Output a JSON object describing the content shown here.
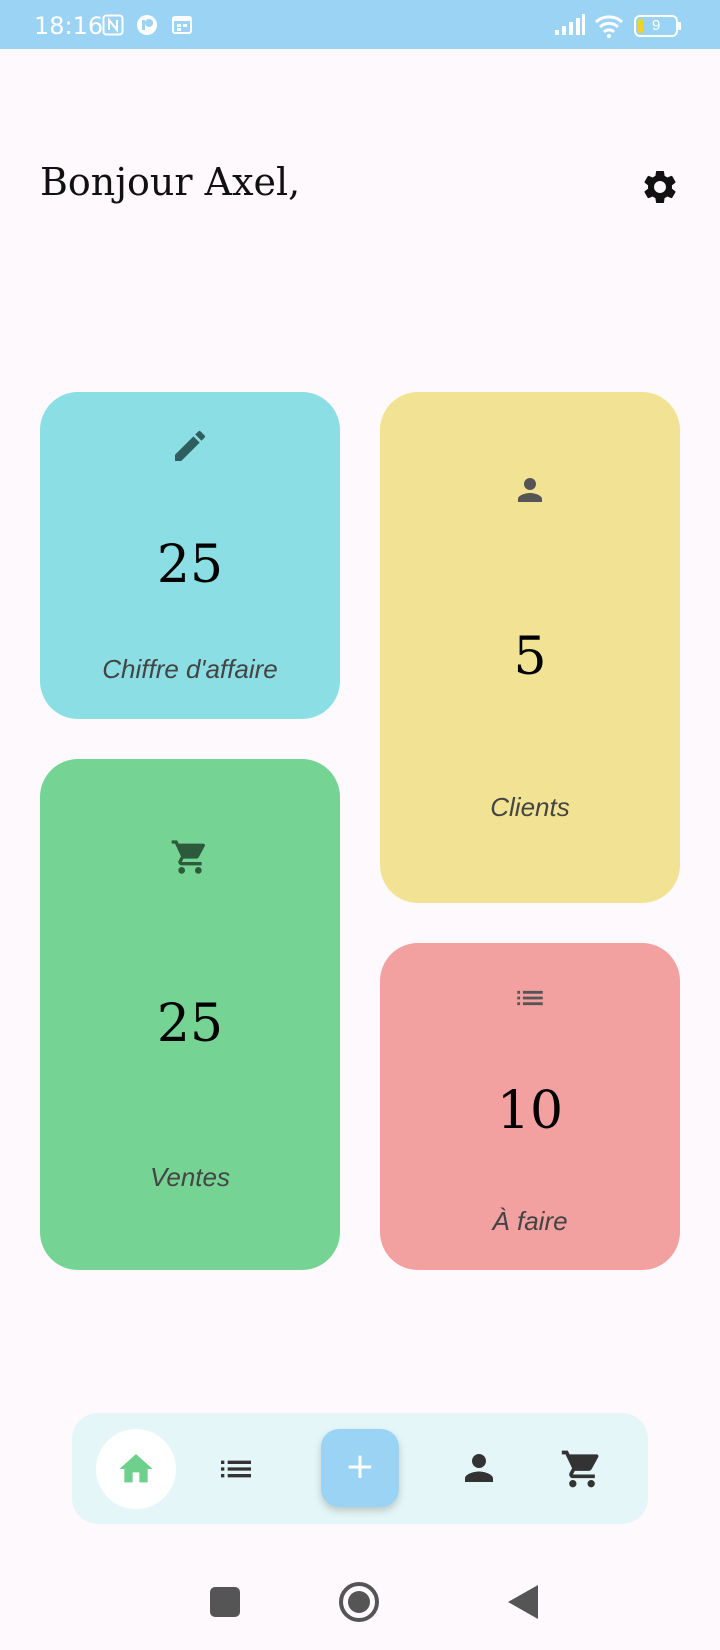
{
  "status_bar": {
    "time": "18:16",
    "battery_level": "9",
    "icons": [
      "nfc-icon",
      "app-notification-icon",
      "calendar-icon",
      "signal-icon",
      "wifi-icon",
      "battery-icon"
    ]
  },
  "header": {
    "greeting": "Bonjour Axel,",
    "settings_icon": "gear-icon"
  },
  "cards": {
    "revenue": {
      "value": "25",
      "label": "Chiffre d'affaire",
      "icon": "pencil-icon",
      "color": "#8bdfe4"
    },
    "clients": {
      "value": "5",
      "label": "Clients",
      "icon": "person-icon",
      "color": "#f2e394"
    },
    "sales": {
      "value": "25",
      "label": "Ventes",
      "icon": "cart-icon",
      "color": "#75d494"
    },
    "todo": {
      "value": "10",
      "label": "À faire",
      "icon": "list-icon",
      "color": "#f2a0a0"
    }
  },
  "bottom_nav": {
    "items": [
      "home-icon",
      "list-icon",
      "add-button",
      "person-icon",
      "cart-icon"
    ],
    "add_label": "+",
    "active": "home",
    "accent": "#6fd08e"
  },
  "system_nav": {
    "items": [
      "recents-button",
      "home-button",
      "back-button"
    ]
  }
}
